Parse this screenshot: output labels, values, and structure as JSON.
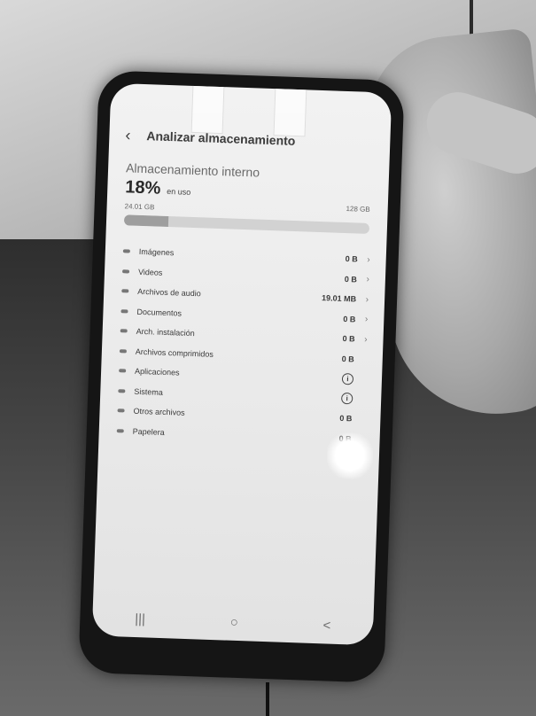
{
  "screen": {
    "title": "Analizar almacenamiento",
    "storage_title": "Almacenamiento interno",
    "percent": "18%",
    "in_use": "en uso",
    "used": "24.01 GB",
    "total": "128 GB",
    "usage_fraction": 0.18
  },
  "items": [
    {
      "label": "Imágenes",
      "value": "0 B",
      "chevron": true
    },
    {
      "label": "Videos",
      "value": "0 B",
      "chevron": true
    },
    {
      "label": "Archivos de audio",
      "value": "19.01 MB",
      "chevron": true
    },
    {
      "label": "Documentos",
      "value": "0 B",
      "chevron": true
    },
    {
      "label": "Arch. instalación",
      "value": "0 B",
      "chevron": true
    },
    {
      "label": "Archivos comprimidos",
      "value": "0 B",
      "chevron": false
    },
    {
      "label": "Aplicaciones",
      "info": "i"
    },
    {
      "label": "Sistema",
      "info": "i"
    },
    {
      "label": "Otros archivos",
      "value": "0 B",
      "chevron": false
    },
    {
      "label": "Papelera",
      "value": "0 B",
      "chevron": false
    }
  ],
  "navbar": {
    "recents": "|||",
    "home": "○",
    "back": "<"
  },
  "icons": {
    "back": "chevron-left-icon",
    "chevron": "chevron-right-icon",
    "info": "info-icon"
  }
}
